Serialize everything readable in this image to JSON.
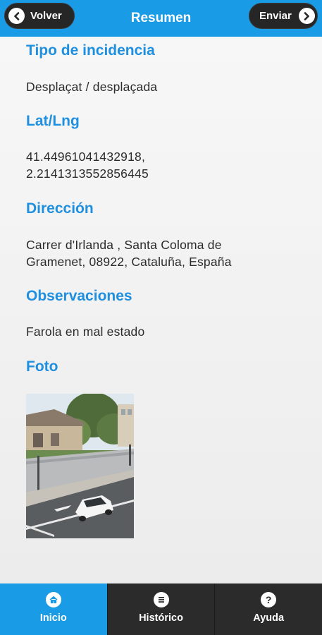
{
  "header": {
    "title": "Resumen",
    "back_label": "Volver",
    "send_label": "Enviar"
  },
  "sections": {
    "tipo": {
      "title": "Tipo de incidencia",
      "value": "Desplaçat / desplaçada"
    },
    "latlng": {
      "title": "Lat/Lng",
      "value_line1": "41.44961041432918,",
      "value_line2": "2.2141313552856445"
    },
    "direccion": {
      "title": "Dirección",
      "value_line1": "Carrer d'Irlanda , Santa Coloma de",
      "value_line2": "Gramenet, 08922, Cataluña, España"
    },
    "observaciones": {
      "title": "Observaciones",
      "value": "Farola en mal estado"
    },
    "foto": {
      "title": "Foto"
    }
  },
  "tabs": [
    {
      "label": "Inicio",
      "icon": "home-icon",
      "active": true
    },
    {
      "label": "Histórico",
      "icon": "list-icon",
      "active": false
    },
    {
      "label": "Ayuda",
      "icon": "help-icon",
      "active": false
    }
  ],
  "colors": {
    "accent": "#1a9be6",
    "title": "#1f8fe0",
    "dark": "#262626"
  }
}
